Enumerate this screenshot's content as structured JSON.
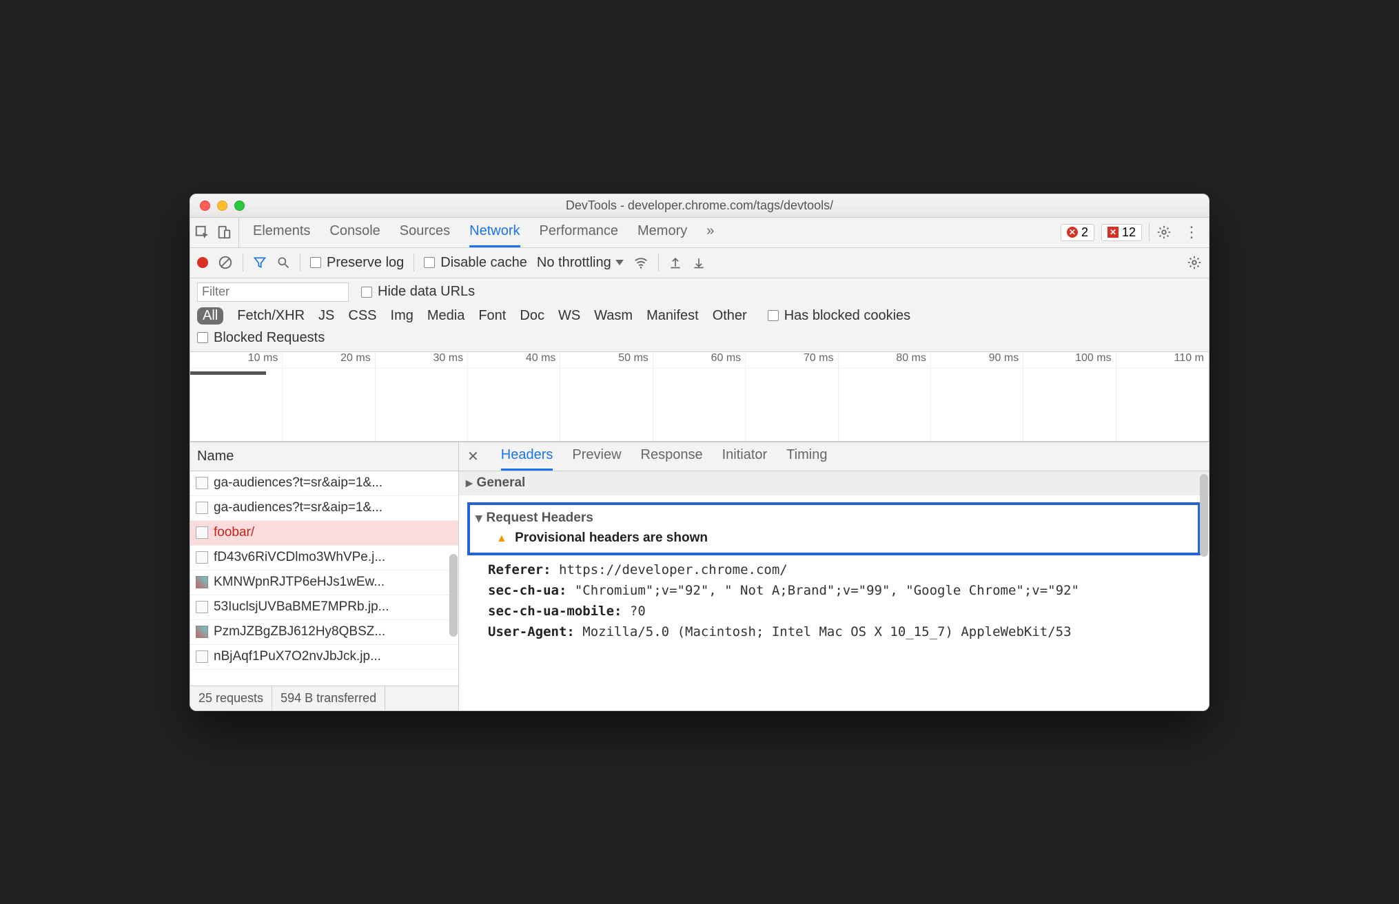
{
  "window": {
    "title": "DevTools - developer.chrome.com/tags/devtools/"
  },
  "main_tabs": {
    "items": [
      "Elements",
      "Console",
      "Sources",
      "Network",
      "Performance",
      "Memory"
    ],
    "active": "Network",
    "overflow_glyph": "»",
    "errors_count": "2",
    "issues_count": "12"
  },
  "net_toolbar": {
    "preserve_log": "Preserve log",
    "disable_cache": "Disable cache",
    "throttling": "No throttling"
  },
  "filters": {
    "placeholder": "Filter",
    "hide_data_urls": "Hide data URLs",
    "types": [
      "All",
      "Fetch/XHR",
      "JS",
      "CSS",
      "Img",
      "Media",
      "Font",
      "Doc",
      "WS",
      "Wasm",
      "Manifest",
      "Other"
    ],
    "active_type": "All",
    "has_blocked_cookies": "Has blocked cookies",
    "blocked_requests": "Blocked Requests"
  },
  "timeline": {
    "ticks": [
      "10 ms",
      "20 ms",
      "30 ms",
      "40 ms",
      "50 ms",
      "60 ms",
      "70 ms",
      "80 ms",
      "90 ms",
      "100 ms",
      "110 m"
    ]
  },
  "requests": {
    "header": "Name",
    "items": [
      {
        "name": "ga-audiences?t=sr&aip=1&...",
        "icon": "blank"
      },
      {
        "name": "ga-audiences?t=sr&aip=1&...",
        "icon": "blank"
      },
      {
        "name": "foobar/",
        "icon": "blank",
        "selected": true
      },
      {
        "name": "fD43v6RiVCDlmo3WhVPe.j...",
        "icon": "blank"
      },
      {
        "name": "KMNWpnRJTP6eHJs1wEw...",
        "icon": "thumb"
      },
      {
        "name": "53IuclsjUVBaBME7MPRb.jp...",
        "icon": "blank"
      },
      {
        "name": "PzmJZBgZBJ612Hy8QBSZ...",
        "icon": "thumb"
      },
      {
        "name": "nBjAqf1PuX7O2nvJbJck.jp...",
        "icon": "blank"
      }
    ],
    "summary": {
      "count": "25 requests",
      "transferred": "594 B transferred"
    }
  },
  "detail": {
    "tabs": [
      "Headers",
      "Preview",
      "Response",
      "Initiator",
      "Timing"
    ],
    "active": "Headers",
    "general_label": "General",
    "request_headers_label": "Request Headers",
    "provisional_warning": "Provisional headers are shown",
    "headers": {
      "referer_k": "Referer:",
      "referer_v": "https://developer.chrome.com/",
      "sec_ua_k": "sec-ch-ua:",
      "sec_ua_v": "\"Chromium\";v=\"92\", \" Not A;Brand\";v=\"99\", \"Google Chrome\";v=\"92\"",
      "sec_ua_mobile_k": "sec-ch-ua-mobile:",
      "sec_ua_mobile_v": "?0",
      "ua_k": "User-Agent:",
      "ua_v": "Mozilla/5.0 (Macintosh; Intel Mac OS X 10_15_7) AppleWebKit/53"
    }
  }
}
